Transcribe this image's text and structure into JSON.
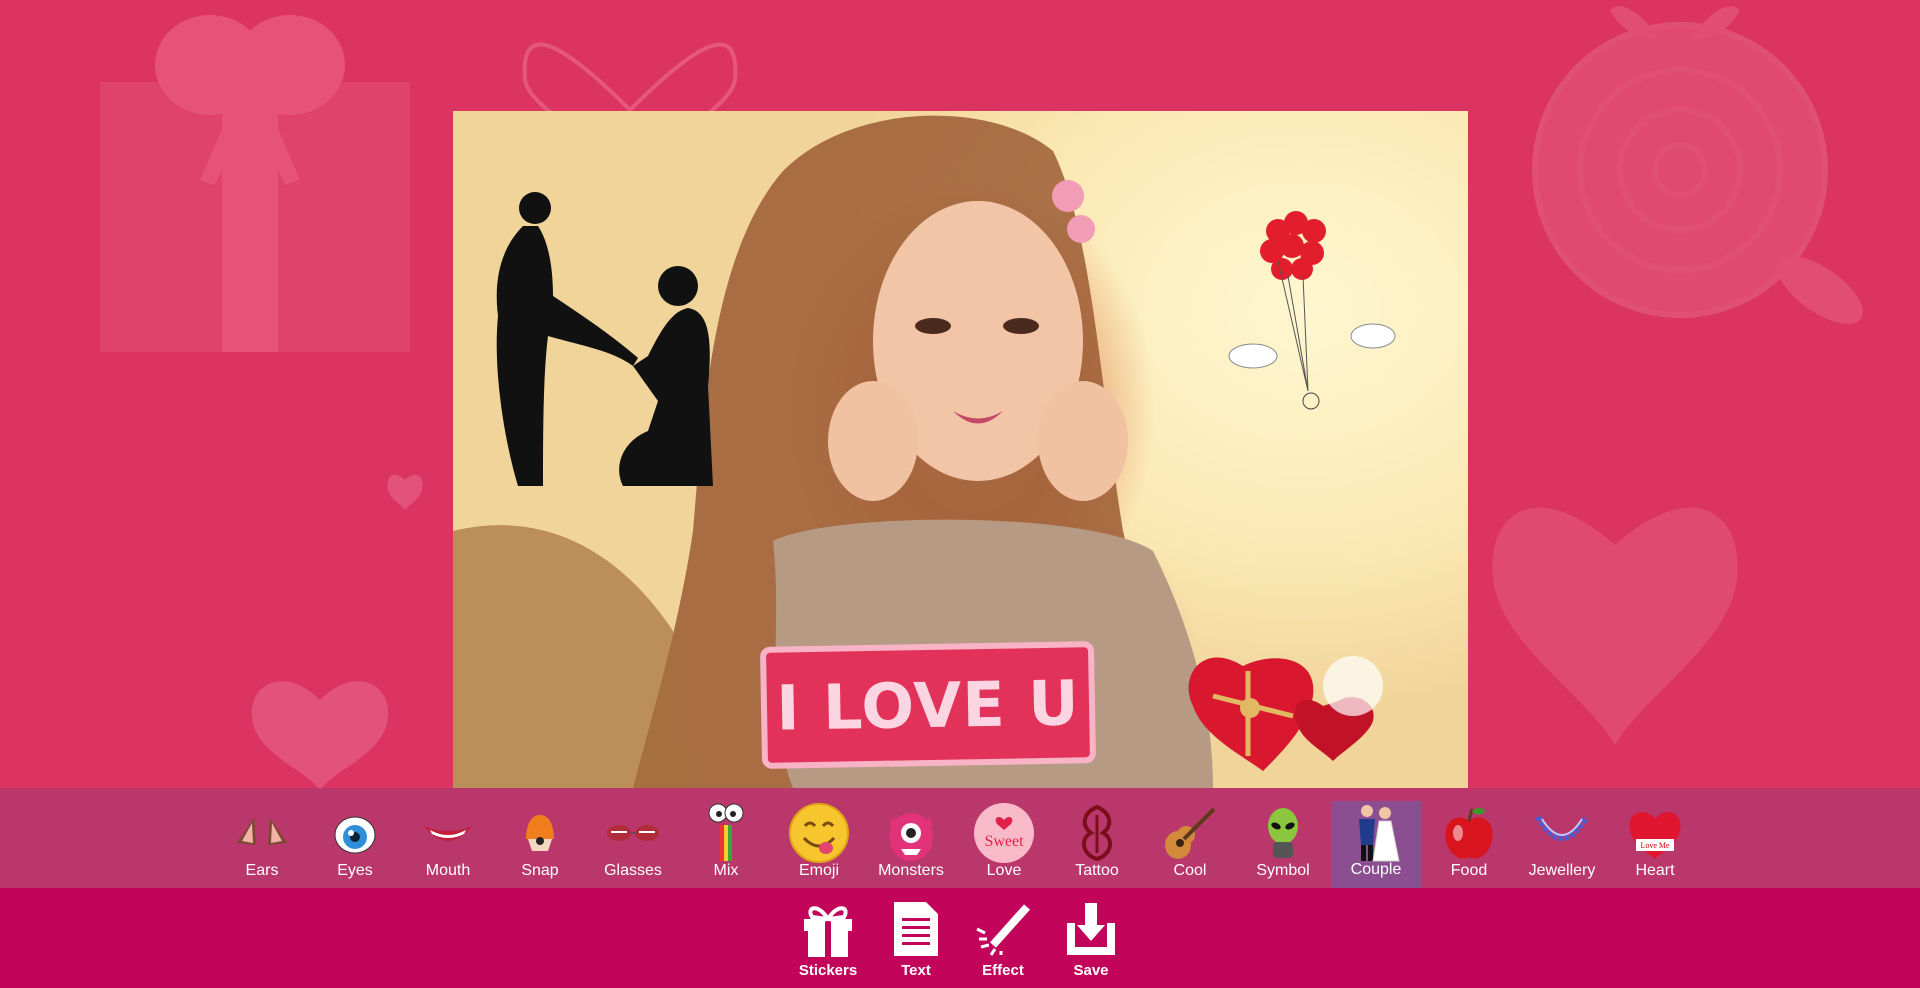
{
  "stickers": [
    {
      "label": "Ears",
      "icon": "ears-icon"
    },
    {
      "label": "Eyes",
      "icon": "eyes-icon"
    },
    {
      "label": "Mouth",
      "icon": "mouth-icon"
    },
    {
      "label": "Snap",
      "icon": "snap-icon"
    },
    {
      "label": "Glasses",
      "icon": "glasses-icon"
    },
    {
      "label": "Mix",
      "icon": "mix-icon"
    },
    {
      "label": "Emoji",
      "icon": "emoji-icon"
    },
    {
      "label": "Monsters",
      "icon": "monster-icon"
    },
    {
      "label": "Love",
      "icon": "love-icon",
      "text": "Sweet"
    },
    {
      "label": "Tattoo",
      "icon": "tattoo-icon"
    },
    {
      "label": "Cool",
      "icon": "guitar-icon"
    },
    {
      "label": "Symbol",
      "icon": "alien-icon"
    },
    {
      "label": "Couple",
      "icon": "couple-icon",
      "selected": true
    },
    {
      "label": "Food",
      "icon": "apple-icon"
    },
    {
      "label": "Jewellery",
      "icon": "necklace-icon"
    },
    {
      "label": "Heart",
      "icon": "heart-icon",
      "text": "Love Me"
    }
  ],
  "tools": [
    {
      "label": "Stickers",
      "icon": "gift-icon"
    },
    {
      "label": "Text",
      "icon": "document-icon"
    },
    {
      "label": "Effect",
      "icon": "magic-wand-icon"
    },
    {
      "label": "Save",
      "icon": "download-icon"
    }
  ],
  "canvas": {
    "banner_text": "I LOVE U",
    "colors": {
      "primary": "#dc3462",
      "sticker_row": "#b9376b",
      "toolbar": "#c2055a",
      "selected": "#8a4e91"
    }
  }
}
